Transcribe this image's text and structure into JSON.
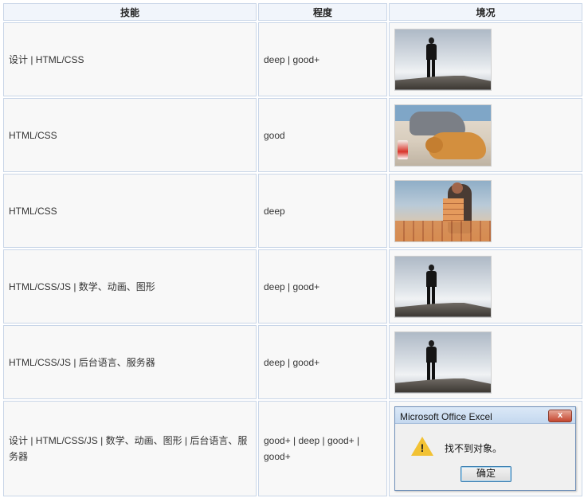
{
  "table": {
    "headers": [
      "技能",
      "程度",
      "境况"
    ],
    "rows": [
      {
        "skill": "设计 | HTML/CSS",
        "level": "deep | good+",
        "image": "man-on-cliff"
      },
      {
        "skill": "HTML/CSS",
        "level": "good",
        "image": "sleeping-man-with-dog"
      },
      {
        "skill": "HTML/CSS",
        "level": "deep",
        "image": "man-carrying-bricks"
      },
      {
        "skill": "HTML/CSS/JS | 数学、动画、图形",
        "level": "deep | good+",
        "image": "man-on-cliff"
      },
      {
        "skill": "HTML/CSS/JS | 后台语言、服务器",
        "level": "deep | good+",
        "image": "man-on-cliff"
      },
      {
        "skill": "设计 | HTML/CSS/JS | 数学、动画、图形 | 后台语言、服务器",
        "level": "good+ | deep | good+ | good+",
        "image": "excel-dialog"
      }
    ]
  },
  "dialog": {
    "title": "Microsoft Office Excel",
    "message": "找不到对象。",
    "ok_label": "确定",
    "close_label": "x",
    "warning_mark": "!"
  },
  "colors": {
    "header_bg": "#f1f5fb",
    "cell_bg": "#f8f8f8",
    "border": "#c9d6e8"
  }
}
